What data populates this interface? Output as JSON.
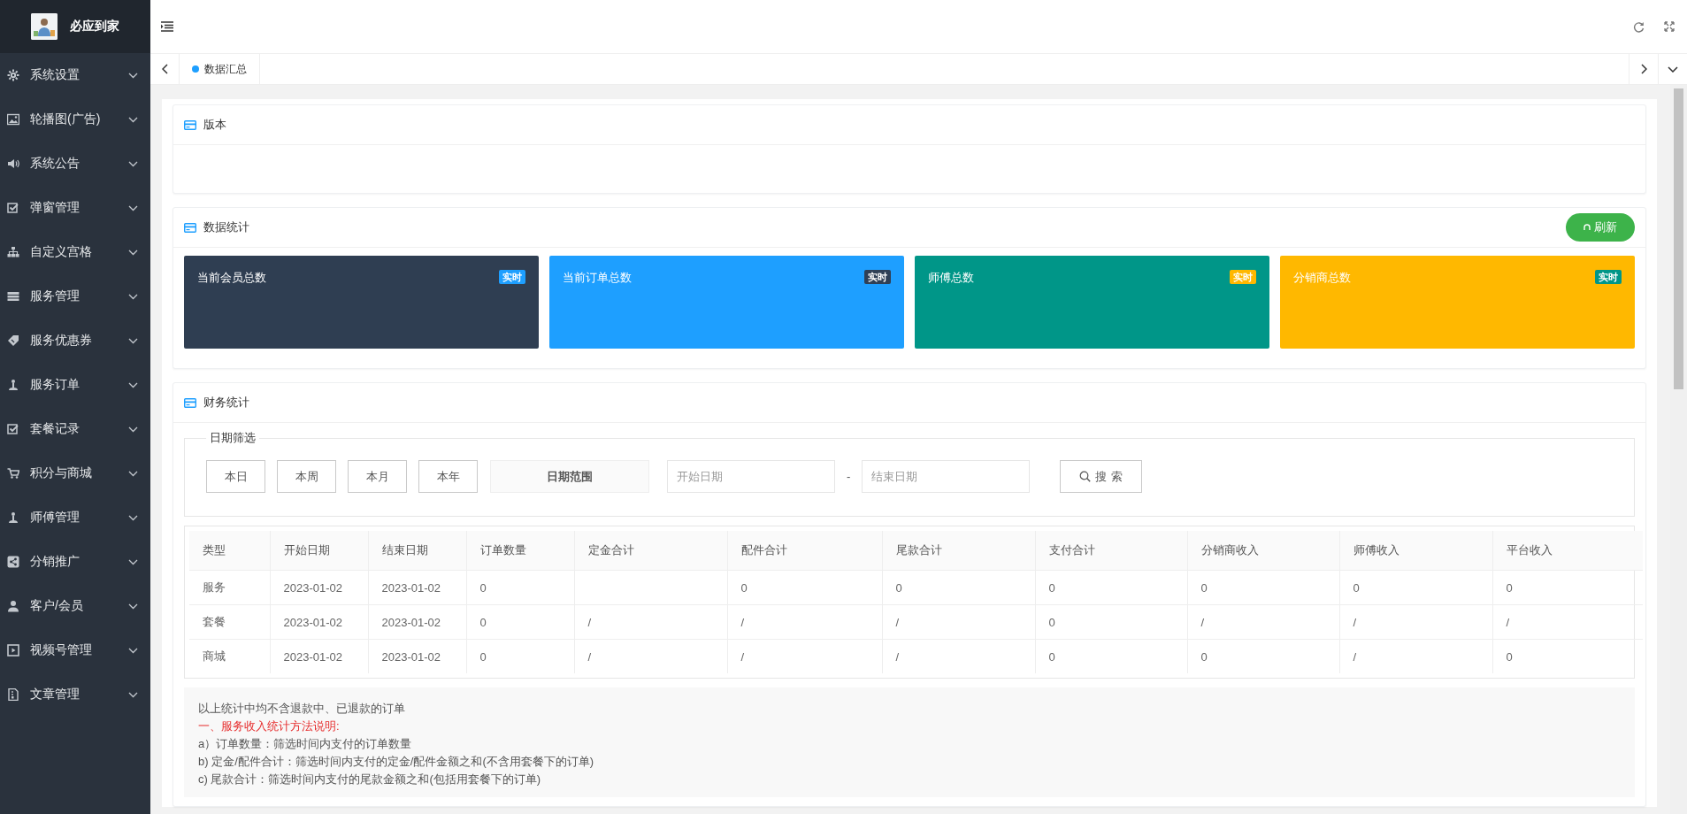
{
  "sidebar": {
    "logo_text": "必应到家",
    "items": [
      {
        "label": "系统设置",
        "kind": "gear"
      },
      {
        "label": "轮播图(广告)",
        "kind": "image"
      },
      {
        "label": "系统公告",
        "kind": "speaker"
      },
      {
        "label": "弹窗管理",
        "kind": "checkbox"
      },
      {
        "label": "自定义宫格",
        "kind": "sitemap"
      },
      {
        "label": "服务管理",
        "kind": "server"
      },
      {
        "label": "服务优惠券",
        "kind": "ticket"
      },
      {
        "label": "服务订单",
        "kind": "worker"
      },
      {
        "label": "套餐记录",
        "kind": "checkbox"
      },
      {
        "label": "积分与商城",
        "kind": "cart"
      },
      {
        "label": "师傅管理",
        "kind": "worker"
      },
      {
        "label": "分销推广",
        "kind": "share"
      },
      {
        "label": "客户/会员",
        "kind": "user"
      },
      {
        "label": "视频号管理",
        "kind": "play"
      },
      {
        "label": "文章管理",
        "kind": "file"
      }
    ]
  },
  "tabs": [
    {
      "label": "数据汇总",
      "selected": true
    }
  ],
  "version_card": {
    "title": "版本"
  },
  "stats": {
    "title": "数据统计",
    "refresh_button": "刷新",
    "tiles": [
      {
        "title": "当前会员总数",
        "badge": {
          "label": "实时",
          "color": "#1e9fff"
        },
        "color": "#2f3e52"
      },
      {
        "title": "当前订单总数",
        "badge": {
          "label": "实时",
          "color": "#2f4056"
        },
        "color": "#1e9fff"
      },
      {
        "title": "师傅总数",
        "badge": {
          "label": "实时",
          "color": "#ffb800"
        },
        "color": "#009688"
      },
      {
        "title": "分销商总数",
        "badge": {
          "label": "实时",
          "color": "#009688"
        },
        "color": "#ffb800"
      }
    ]
  },
  "finance": {
    "title": "财务统计",
    "filter_legend": "日期筛选",
    "period_buttons": [
      "本日",
      "本周",
      "本月",
      "本年"
    ],
    "range_label": "日期范围",
    "start_placeholder": "开始日期",
    "separator": "-",
    "end_placeholder": "结束日期",
    "search_button": "搜 索",
    "table": {
      "columns": [
        "类型",
        "开始日期",
        "结束日期",
        "订单数量",
        "定金合计",
        "配件合计",
        "尾款合计",
        "支付合计",
        "分销商收入",
        "师傅收入",
        "平台收入"
      ],
      "rows": [
        [
          "服务",
          "2023-01-02",
          "2023-01-02",
          "0",
          "",
          "0",
          "0",
          "0",
          "0",
          "0",
          "0"
        ],
        [
          "套餐",
          "2023-01-02",
          "2023-01-02",
          "0",
          "/",
          "/",
          "/",
          "0",
          "/",
          "/",
          "/"
        ],
        [
          "商城",
          "2023-01-02",
          "2023-01-02",
          "0",
          "/",
          "/",
          "/",
          "0",
          "0",
          "/",
          "0"
        ]
      ]
    },
    "notes": [
      {
        "kind": "plain",
        "text": "以上统计中均不含退款中、已退款的订单"
      },
      {
        "kind": "heading",
        "text": "一、服务收入统计方法说明:"
      },
      {
        "kind": "plain",
        "text": "a）订单数量：筛选时间内支付的订单数量"
      },
      {
        "kind": "plain",
        "text": "b) 定金/配件合计：筛选时间内支付的定金/配件金额之和(不含用套餐下的订单)"
      },
      {
        "kind": "plain",
        "text": "c) 尾款合计：筛选时间内支付的尾款金额之和(包括用套餐下的订单)"
      }
    ]
  }
}
